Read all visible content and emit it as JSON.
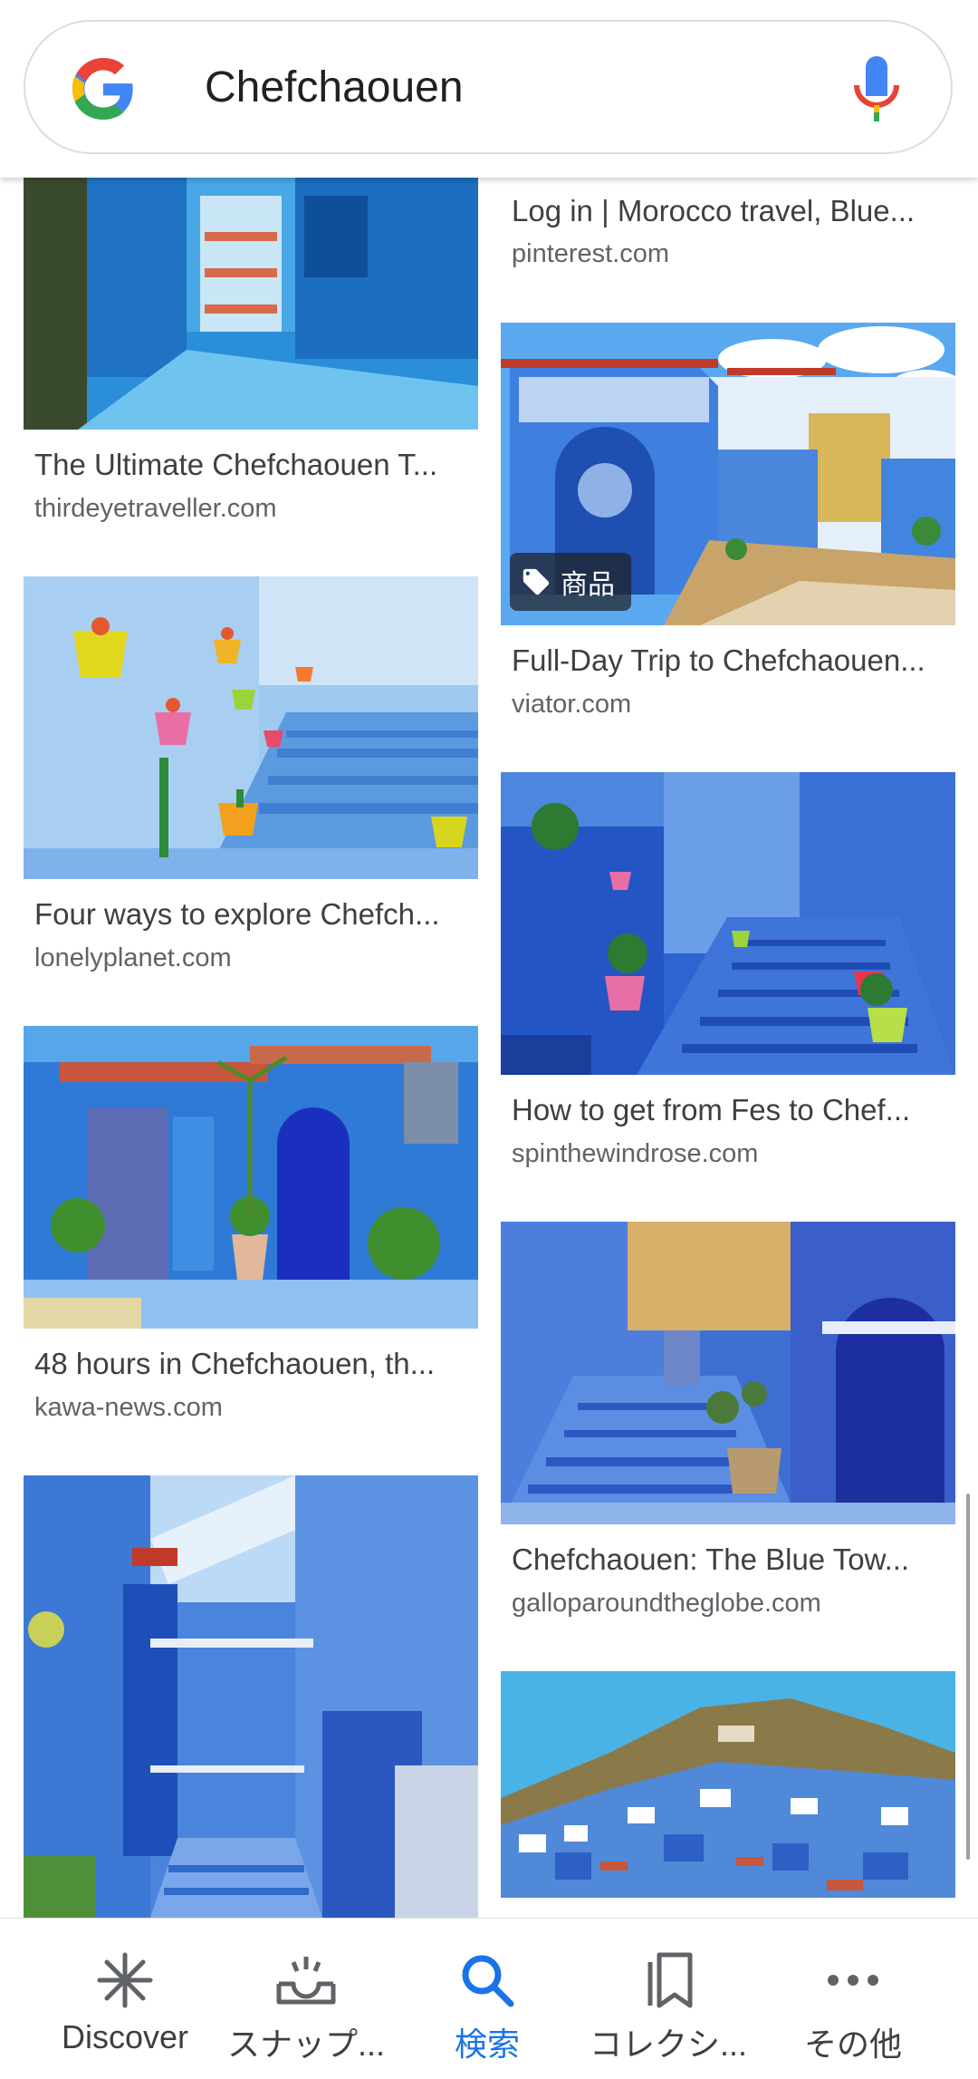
{
  "search": {
    "query": "Chefchaouen"
  },
  "results": {
    "left": [
      {
        "title": "The Ultimate Chefchaouen T...",
        "source": "thirdeyetraveller.com"
      },
      {
        "title": "Four ways to explore Chefch...",
        "source": "lonelyplanet.com"
      },
      {
        "title": "48 hours in Chefchaouen, th...",
        "source": "kawa-news.com"
      },
      {
        "title": "",
        "source": ""
      }
    ],
    "right": [
      {
        "title": "Log in | Morocco travel, Blue...",
        "source": "pinterest.com"
      },
      {
        "title": "Full-Day Trip to Chefchaouen...",
        "source": "viator.com",
        "tag": "商品"
      },
      {
        "title": "How to get from Fes to Chef...",
        "source": "spinthewindrose.com"
      },
      {
        "title": "Chefchaouen: The Blue Tow...",
        "source": "galloparoundtheglobe.com"
      },
      {
        "title": "",
        "source": ""
      }
    ]
  },
  "nav": {
    "items": [
      {
        "label": "Discover",
        "icon": "asterisk-icon"
      },
      {
        "label": "スナップ...",
        "icon": "snapshot-tray-icon"
      },
      {
        "label": "検索",
        "icon": "search-icon"
      },
      {
        "label": "コレクシ...",
        "icon": "collections-bookmark-icon"
      },
      {
        "label": "その他",
        "icon": "more-horiz-icon"
      }
    ],
    "active_label": "検索"
  },
  "colors": {
    "accent": "#1a73e8",
    "text_primary": "#3c4043",
    "text_secondary": "#5f6368",
    "chefchaouen_blue": "#2f6fd8"
  }
}
